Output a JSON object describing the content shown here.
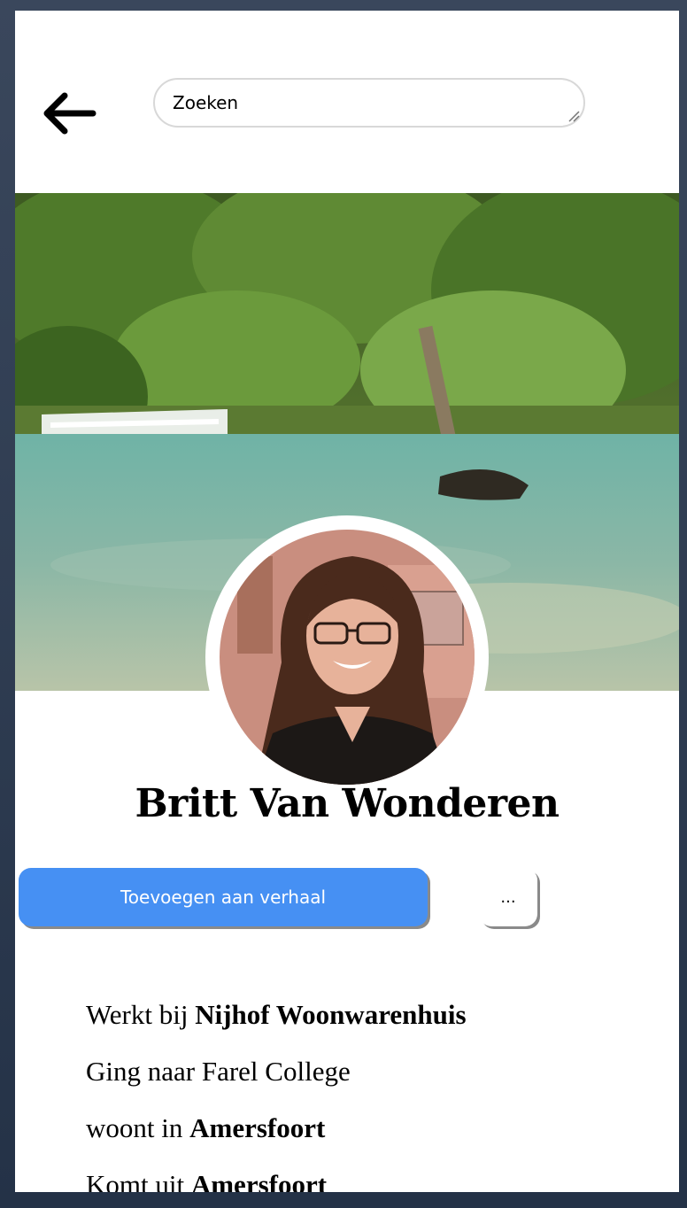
{
  "header": {
    "back_icon": "arrow-left-icon",
    "search_value": "Zoeken"
  },
  "profile": {
    "name": "Britt Van Wonderen",
    "cover_alt": "Jungle waterfall and turquoise pool",
    "avatar_alt": "Profile photo"
  },
  "actions": {
    "add_story_label": "Toevoegen aan verhaal",
    "more_label": "...",
    "accent_color": "#4690f3"
  },
  "info": {
    "work_prefix": "Werkt bij ",
    "work_value": "Nijhof Woonwarenhuis",
    "school_text": "Ging naar Farel College",
    "lives_prefix": "woont in ",
    "lives_value": "Amersfoort",
    "from_prefix": "Komt uit ",
    "from_value": "Amersfoort"
  }
}
